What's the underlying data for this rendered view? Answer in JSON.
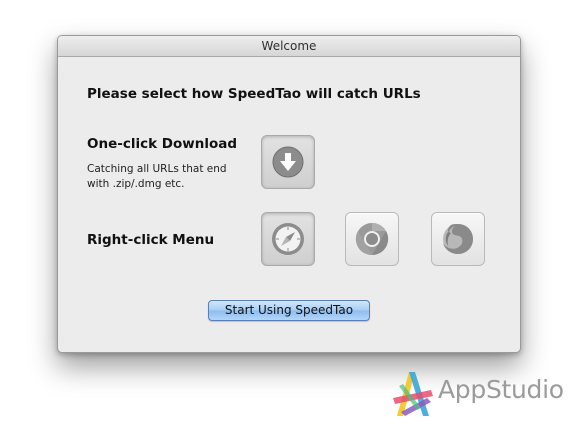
{
  "window": {
    "title": "Welcome"
  },
  "content": {
    "heading": "Please select how SpeedTao will catch URLs",
    "one_click": {
      "title": "One-click Download",
      "description": "Catching all URLs that end with .zip/.dmg etc.",
      "icon": "download-icon",
      "selected": true
    },
    "right_click": {
      "title": "Right-click Menu",
      "browsers": [
        {
          "icon": "safari-icon",
          "selected": true
        },
        {
          "icon": "chrome-icon",
          "selected": false
        },
        {
          "icon": "firefox-icon",
          "selected": false
        }
      ]
    },
    "start_button": "Start Using SpeedTao"
  },
  "watermark": {
    "text": "AppStudio"
  },
  "colors": {
    "window_bg": "#ececec",
    "icon_gray": "#8c8c8c",
    "button_blue": "#a7cdf3"
  }
}
